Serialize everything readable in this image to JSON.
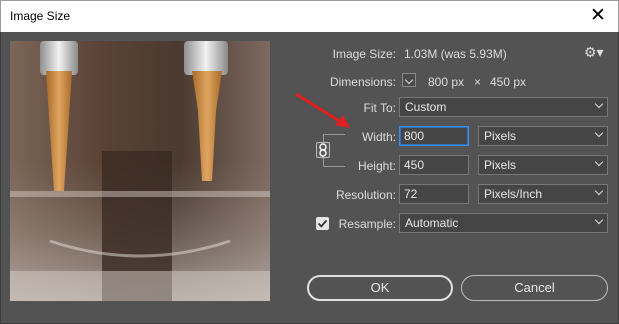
{
  "window": {
    "title": "Image Size",
    "close_glyph": "✕"
  },
  "info": {
    "image_size_label": "Image Size:",
    "image_size_value": "1.03M (was 5.93M)",
    "dimensions_label": "Dimensions:",
    "dim_width": "800 px",
    "dim_times": "×",
    "dim_height": "450 px"
  },
  "fields": {
    "fit_to_label": "Fit To:",
    "fit_to_value": "Custom",
    "width_label": "Width:",
    "width_value": "800",
    "width_unit": "Pixels",
    "height_label": "Height:",
    "height_value": "450",
    "height_unit": "Pixels",
    "resolution_label": "Resolution:",
    "resolution_value": "72",
    "resolution_unit": "Pixels/Inch",
    "resample_label": "Resample:",
    "resample_checked": true,
    "resample_value": "Automatic"
  },
  "buttons": {
    "ok": "OK",
    "cancel": "Cancel"
  },
  "icons": {
    "gear": "gear-icon",
    "link": "constrain-proportions-link-icon",
    "close": "close-icon",
    "arrow": "annotation-arrow"
  },
  "colors": {
    "focus": "#3d8ee9",
    "annotation": "#e0201f",
    "background": "#535353"
  }
}
